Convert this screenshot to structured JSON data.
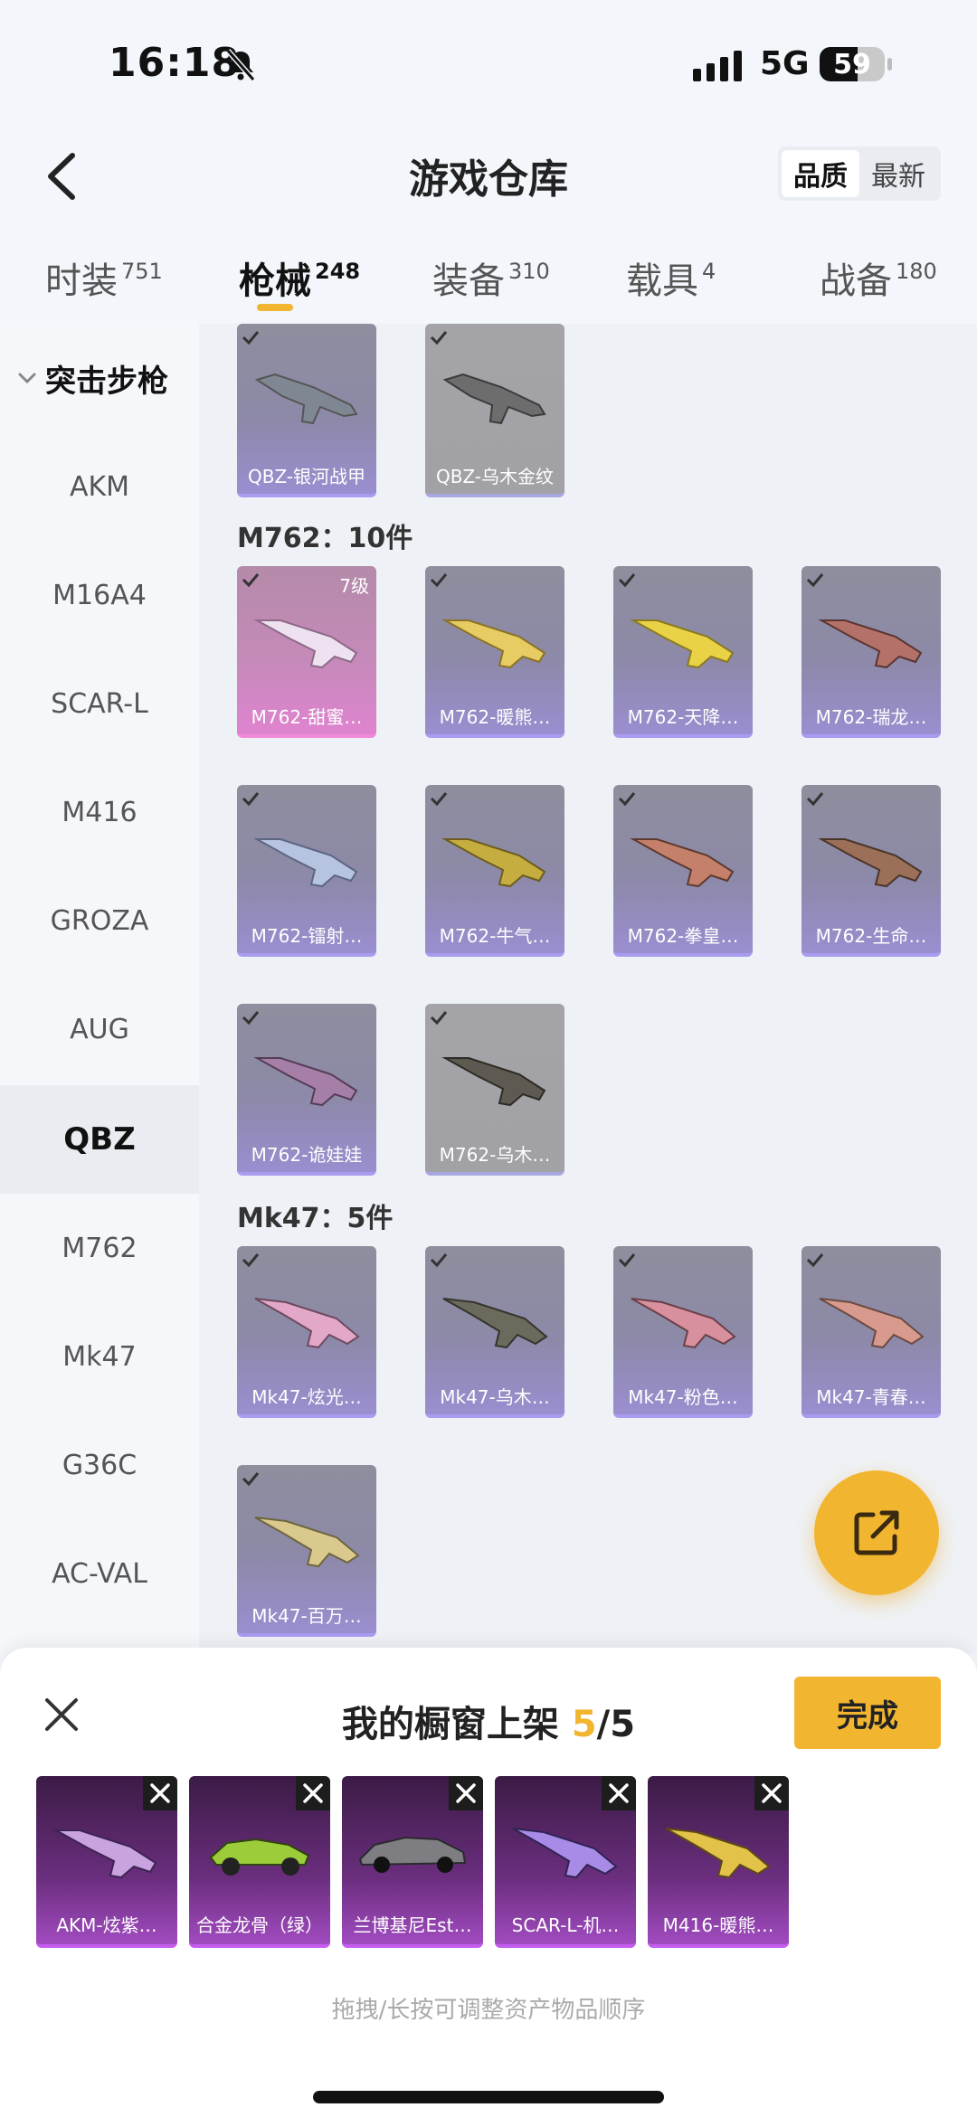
{
  "status": {
    "time": "16:18",
    "network": "5G",
    "battery": "59",
    "battery_level": 0.59
  },
  "header": {
    "title": "游戏仓库",
    "sort_options": [
      "品质",
      "最新"
    ],
    "sort_active": 0
  },
  "tabs": [
    {
      "label": "时装",
      "count": "751"
    },
    {
      "label": "枪械",
      "count": "248"
    },
    {
      "label": "装备",
      "count": "310"
    },
    {
      "label": "载具",
      "count": "4"
    },
    {
      "label": "战备",
      "count": "180"
    }
  ],
  "sidebar": {
    "heading": "突击步枪",
    "items": [
      "AKM",
      "M16A4",
      "SCAR-L",
      "M416",
      "GROZA",
      "AUG",
      "QBZ",
      "M762",
      "Mk47",
      "G36C",
      "AC-VAL"
    ],
    "active_index": 6
  },
  "groups": {
    "qbz": {
      "items": [
        "QBZ-银河战甲",
        "QBZ-乌木金纹"
      ]
    },
    "m762": {
      "title": "M762：10件",
      "level": "7级",
      "items": [
        "M762-甜蜜…",
        "M762-暖熊…",
        "M762-天降…",
        "M762-瑞龙…",
        "M762-镭射…",
        "M762-牛气…",
        "M762-拳皇…",
        "M762-生命…",
        "M762-诡娃娃",
        "M762-乌木…"
      ]
    },
    "mk47": {
      "title": "Mk47：5件",
      "items": [
        "Mk47-炫光…",
        "Mk47-乌木…",
        "Mk47-粉色…",
        "Mk47-青春…",
        "Mk47-百万…"
      ]
    }
  },
  "sheet": {
    "title_prefix": "我的橱窗上架",
    "count": "5",
    "total": "/5",
    "done_label": "完成",
    "items": [
      "AKM-炫紫…",
      "合金龙骨（绿）",
      "兰博基尼Est…",
      "SCAR-L-机…",
      "M416-暖熊…"
    ],
    "hint": "拖拽/长按可调整资产物品顺序"
  },
  "colors": {
    "accent": "#f2b530",
    "card_epic": "#9a8ed0",
    "card_legend": "#df83cf",
    "shelf": "#a14bc0"
  }
}
